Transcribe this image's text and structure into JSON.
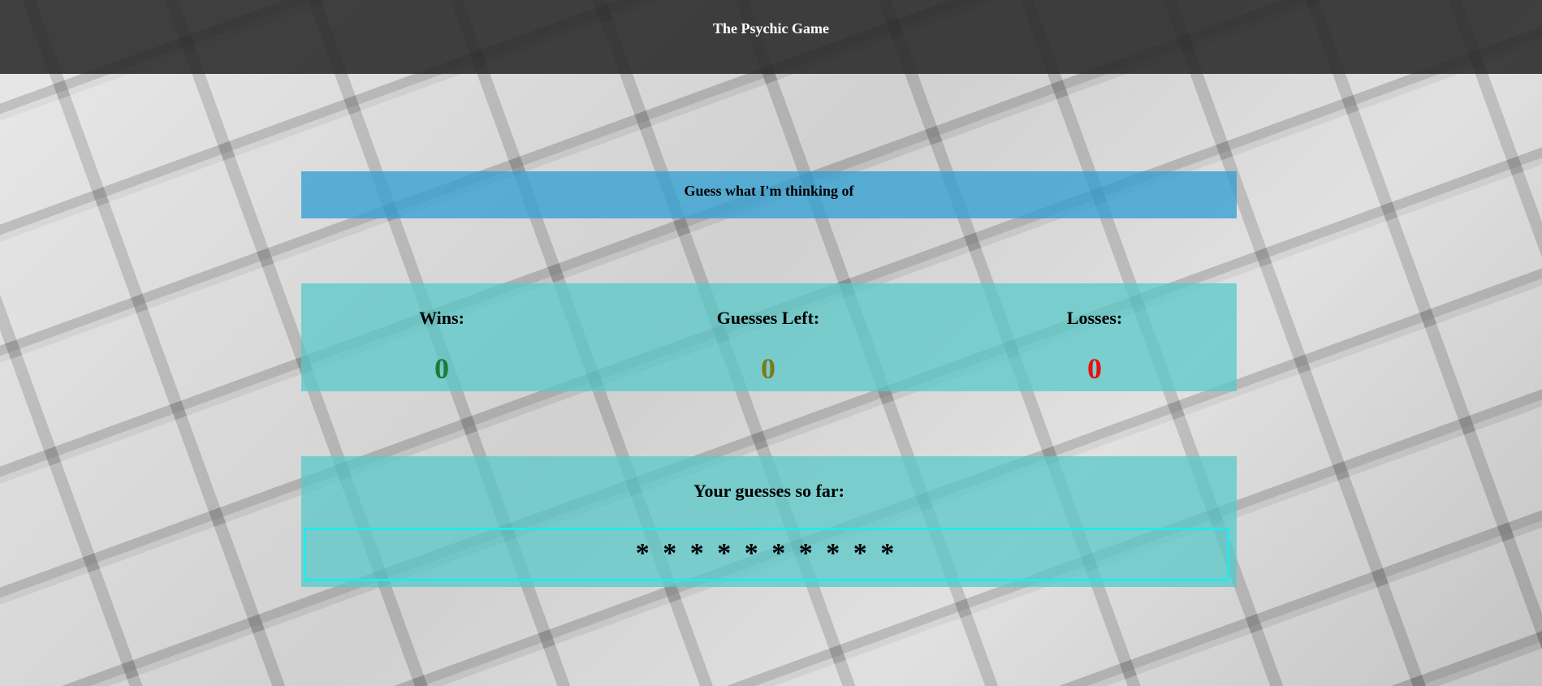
{
  "header": {
    "title": "The Psychic Game"
  },
  "prompt": {
    "text": "Guess what I'm thinking of"
  },
  "stats": {
    "wins": {
      "label": "Wins:",
      "value": "0",
      "color": "#1e7a3a"
    },
    "guesses_left": {
      "label": "Guesses Left:",
      "value": "0",
      "color": "#7a7a1e"
    },
    "losses": {
      "label": "Losses:",
      "value": "0",
      "color": "#e81010"
    }
  },
  "guesses": {
    "label": "Your guesses so far:",
    "value": "* * * * * * * * * *"
  },
  "colors": {
    "topbar": "#282828",
    "prompt_panel": "#32a0d2",
    "stats_panel": "#5ac8c8",
    "guesses_border": "#27e8ea"
  }
}
